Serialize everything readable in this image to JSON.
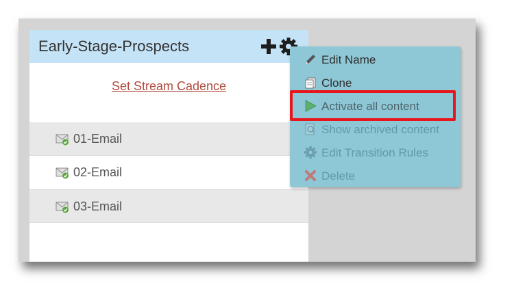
{
  "stream": {
    "title": "Early-Stage-Prospects",
    "cadence_link": "Set Stream Cadence",
    "emails": [
      {
        "label": "01-Email"
      },
      {
        "label": "02-Email"
      },
      {
        "label": "03-Email"
      }
    ]
  },
  "header_icons": [
    "plus-icon",
    "gear-icon"
  ],
  "menu": {
    "items": [
      {
        "label": "Edit Name",
        "icon": "pencil-icon",
        "enabled": true
      },
      {
        "label": "Clone",
        "icon": "document-icon",
        "enabled": true
      },
      {
        "label": "Activate all content",
        "icon": "play-icon",
        "enabled": true,
        "highlighted": true
      },
      {
        "label": "Show archived content",
        "icon": "archive-icon",
        "enabled": false
      },
      {
        "label": "Edit Transition Rules",
        "icon": "gear-icon",
        "enabled": false
      },
      {
        "label": "Delete",
        "icon": "delete-x-icon",
        "enabled": false
      }
    ]
  },
  "colors": {
    "header_bg": "#c5e3f6",
    "menu_bg": "#8ec7d6",
    "highlight_border": "#e8161b",
    "link_color": "#b04a3e"
  }
}
